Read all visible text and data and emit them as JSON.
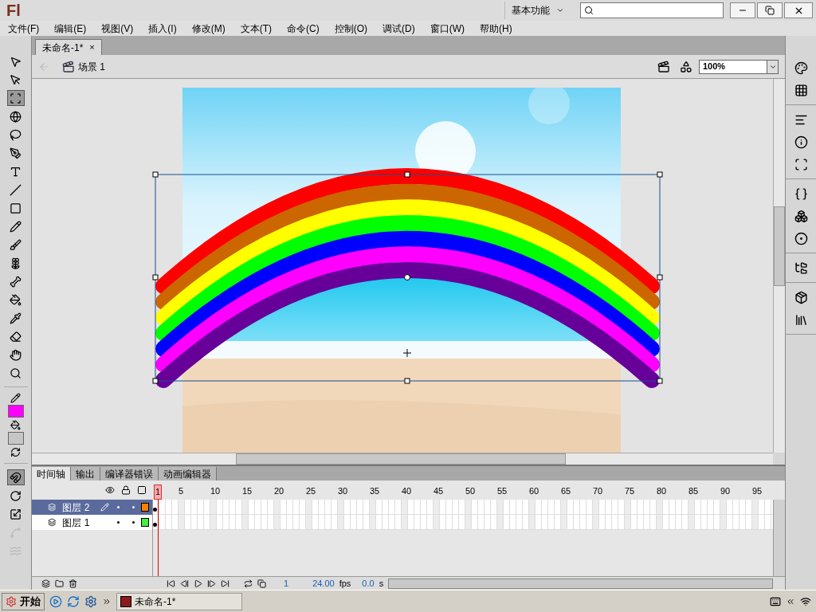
{
  "app": {
    "logo": "Fl",
    "workspace": "基本功能"
  },
  "menu": [
    "文件(F)",
    "编辑(E)",
    "视图(V)",
    "插入(I)",
    "修改(M)",
    "文本(T)",
    "命令(C)",
    "控制(O)",
    "调试(D)",
    "窗口(W)",
    "帮助(H)"
  ],
  "document_tabs": [
    {
      "label": "未命名-1*",
      "close": "×",
      "selected": true
    }
  ],
  "scene": {
    "label": "场景 1",
    "zoom": "100%"
  },
  "tools": [
    {
      "kind": "selection",
      "selected": false
    },
    {
      "kind": "subselection",
      "selected": false
    },
    {
      "kind": "transform",
      "selected": true
    },
    {
      "kind": "rotate3d",
      "selected": false
    },
    {
      "kind": "lasso",
      "selected": false
    },
    {
      "kind": "pen",
      "selected": false
    },
    {
      "kind": "text",
      "selected": false
    },
    {
      "kind": "line",
      "selected": false
    },
    {
      "kind": "rectangle",
      "selected": false
    },
    {
      "kind": "pencil",
      "selected": false
    },
    {
      "kind": "brush",
      "selected": false
    },
    {
      "kind": "deco",
      "selected": false
    },
    {
      "kind": "bone",
      "selected": false
    },
    {
      "kind": "bucket",
      "selected": false
    },
    {
      "kind": "eyedropper",
      "selected": false
    },
    {
      "kind": "eraser",
      "selected": false
    },
    {
      "kind": "hand",
      "selected": false
    },
    {
      "kind": "zoom",
      "selected": false
    }
  ],
  "swatches": [
    {
      "kind": "stroke",
      "color": "#ff00ff"
    },
    {
      "kind": "fill",
      "color": "#c6c6c6"
    }
  ],
  "options": [
    {
      "kind": "snap",
      "selected": true,
      "disabled": false
    },
    {
      "kind": "rotate",
      "selected": false,
      "disabled": false
    },
    {
      "kind": "scale",
      "selected": false,
      "disabled": false
    },
    {
      "kind": "distort",
      "selected": false,
      "disabled": true
    },
    {
      "kind": "envelope",
      "selected": false,
      "disabled": true
    }
  ],
  "panel_groups": [
    {
      "items": [
        {
          "kind": "color"
        },
        {
          "kind": "swatches"
        }
      ]
    },
    {
      "items": [
        {
          "kind": "align"
        },
        {
          "kind": "info"
        },
        {
          "kind": "transform"
        }
      ]
    },
    {
      "items": [
        {
          "kind": "code"
        },
        {
          "kind": "components"
        },
        {
          "kind": "presets"
        }
      ]
    },
    {
      "items": [
        {
          "kind": "library"
        }
      ]
    },
    {
      "items": [
        {
          "kind": "properties"
        },
        {
          "kind": "books"
        }
      ]
    }
  ],
  "timeline": {
    "tabs": [
      {
        "label": "时间轴",
        "selected": true
      },
      {
        "label": "输出",
        "selected": false
      },
      {
        "label": "编译器错误",
        "selected": false
      },
      {
        "label": "动画编辑器",
        "selected": false
      }
    ],
    "ruler": [
      "1",
      "5",
      "10",
      "15",
      "20",
      "25",
      "30",
      "35",
      "40",
      "45",
      "50",
      "55",
      "60",
      "65",
      "70",
      "75",
      "80",
      "85",
      "90",
      "95"
    ],
    "layers": [
      {
        "name": "图层 2",
        "selected": true,
        "editing": true,
        "visible": true,
        "locked": false,
        "color": "#ff8000"
      },
      {
        "name": "图层 1",
        "selected": false,
        "editing": false,
        "visible": true,
        "locked": false,
        "color": "#44ee44"
      }
    ],
    "status": {
      "frame": "1",
      "fps": "24.00",
      "fps_unit": "fps",
      "time": "0.0",
      "time_unit": "s"
    }
  },
  "taskbar": {
    "start": "开始",
    "tasks": [
      {
        "label": "未命名-1*",
        "selected": false
      }
    ]
  }
}
